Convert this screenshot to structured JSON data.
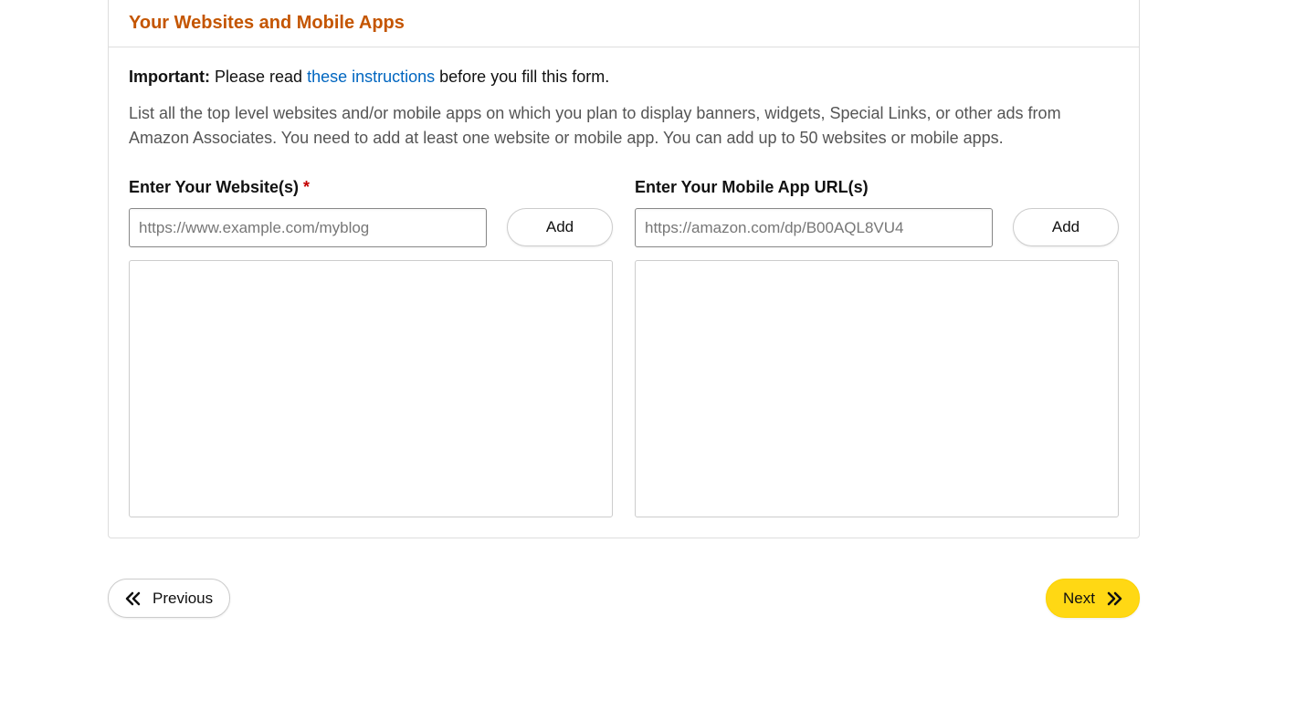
{
  "section": {
    "title": "Your Websites and Mobile Apps"
  },
  "important": {
    "label": "Important:",
    "before": " Please read ",
    "link": "these instructions",
    "after": " before you fill this form."
  },
  "description": "List all the top level websites and/or mobile apps on which you plan to display banners, widgets, Special Links, or other ads from Amazon Associates. You need to add at least one website or mobile app. You can add up to 50 websites or mobile apps.",
  "websites": {
    "label": "Enter Your Website(s) ",
    "required": "*",
    "placeholder": "https://www.example.com/myblog",
    "add_label": "Add"
  },
  "mobile": {
    "label": "Enter Your Mobile App URL(s)",
    "placeholder": "https://amazon.com/dp/B00AQL8VU4",
    "add_label": "Add"
  },
  "nav": {
    "previous": "Previous",
    "next": "Next"
  }
}
